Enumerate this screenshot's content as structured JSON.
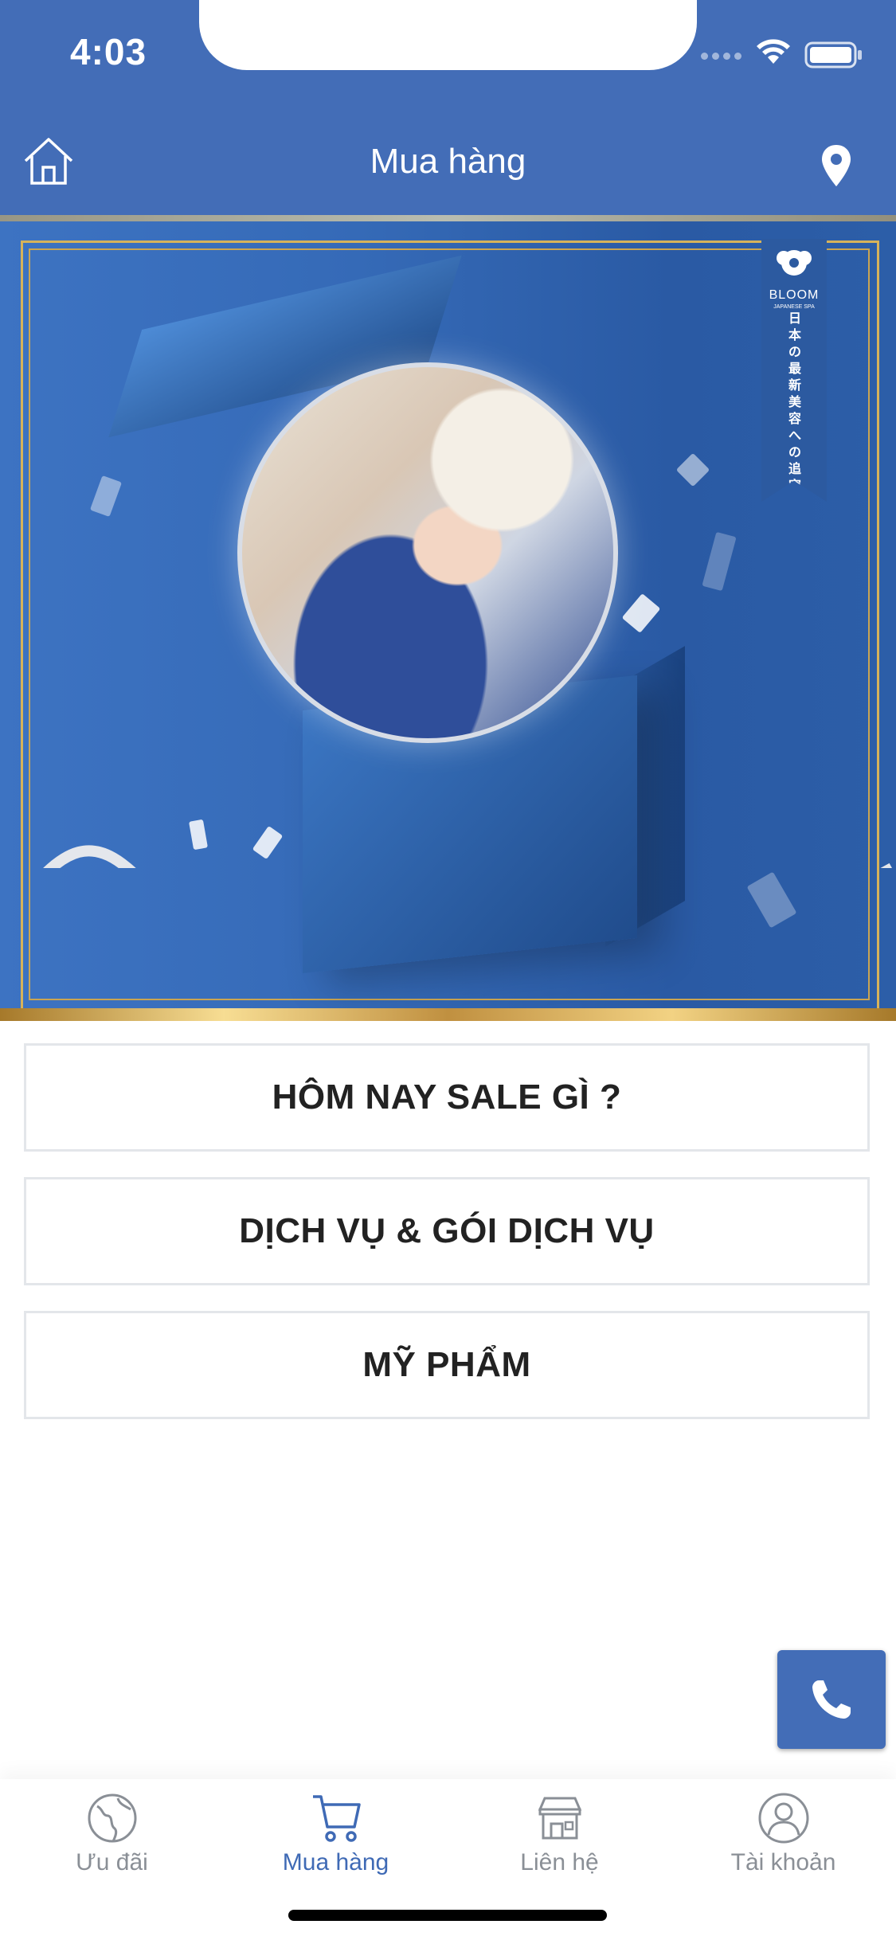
{
  "status_bar": {
    "time": "4:03"
  },
  "header": {
    "title": "Mua hàng"
  },
  "banner": {
    "brand_text": "BLOOM",
    "brand_sub": "JAPANESE SPA",
    "vertical_text": "日本の最新美容への追究"
  },
  "menu": [
    {
      "label": "HÔM NAY SALE GÌ ?"
    },
    {
      "label": "DỊCH VỤ & GÓI DỊCH VỤ"
    },
    {
      "label": "MỸ PHẨM"
    }
  ],
  "tabs": [
    {
      "label": "Ưu đãi",
      "icon": "globe-icon",
      "active": false
    },
    {
      "label": "Mua hàng",
      "icon": "cart-icon",
      "active": true
    },
    {
      "label": "Liên hệ",
      "icon": "store-icon",
      "active": false
    },
    {
      "label": "Tài khoản",
      "icon": "user-icon",
      "active": false
    }
  ],
  "colors": {
    "primary": "#436db7",
    "tab_inactive": "#8a8f96",
    "tab_active": "#3f6ab5",
    "gold": "#d7b35a"
  }
}
